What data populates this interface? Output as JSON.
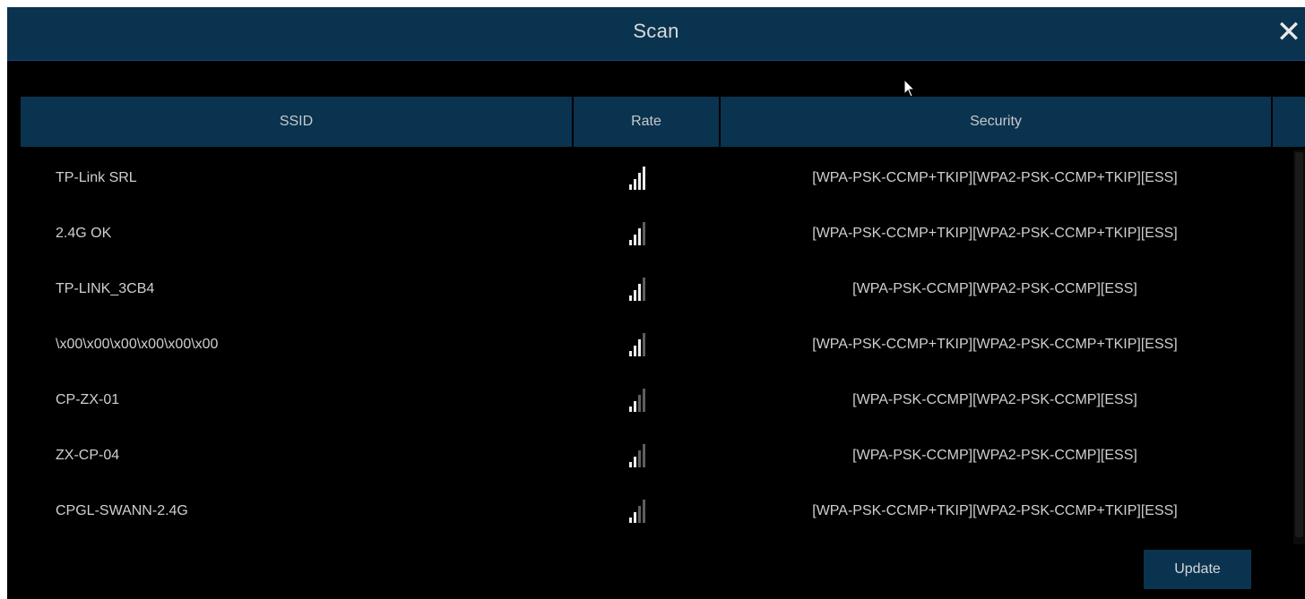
{
  "dialog": {
    "title": "Scan",
    "close_glyph": "✕"
  },
  "table": {
    "columns": [
      "SSID",
      "Rate",
      "Security",
      ""
    ],
    "rows": [
      {
        "ssid": "TP-Link SRL",
        "signal_level": 4,
        "security": "[WPA-PSK-CCMP+TKIP][WPA2-PSK-CCMP+TKIP][ESS]"
      },
      {
        "ssid": "2.4G OK",
        "signal_level": 3,
        "security": "[WPA-PSK-CCMP+TKIP][WPA2-PSK-CCMP+TKIP][ESS]"
      },
      {
        "ssid": "TP-LINK_3CB4",
        "signal_level": 3,
        "security": "[WPA-PSK-CCMP][WPA2-PSK-CCMP][ESS]"
      },
      {
        "ssid": "\\x00\\x00\\x00\\x00\\x00\\x00",
        "signal_level": 3,
        "security": "[WPA-PSK-CCMP+TKIP][WPA2-PSK-CCMP+TKIP][ESS]"
      },
      {
        "ssid": "CP-ZX-01",
        "signal_level": 2,
        "security": "[WPA-PSK-CCMP][WPA2-PSK-CCMP][ESS]"
      },
      {
        "ssid": "ZX-CP-04",
        "signal_level": 2,
        "security": "[WPA-PSK-CCMP][WPA2-PSK-CCMP][ESS]"
      },
      {
        "ssid": "CPGL-SWANN-2.4G",
        "signal_level": 2,
        "security": "[WPA-PSK-CCMP+TKIP][WPA2-PSK-CCMP+TKIP][ESS]"
      }
    ]
  },
  "icons": {
    "signal": "wifi-signal-icon",
    "close": "close-icon",
    "cursor": "mouse-cursor-icon"
  },
  "actions": {
    "update_label": "Update"
  },
  "colors": {
    "header_bg": "#0a3350",
    "body_bg": "#000000",
    "text": "#cfcfcf"
  }
}
